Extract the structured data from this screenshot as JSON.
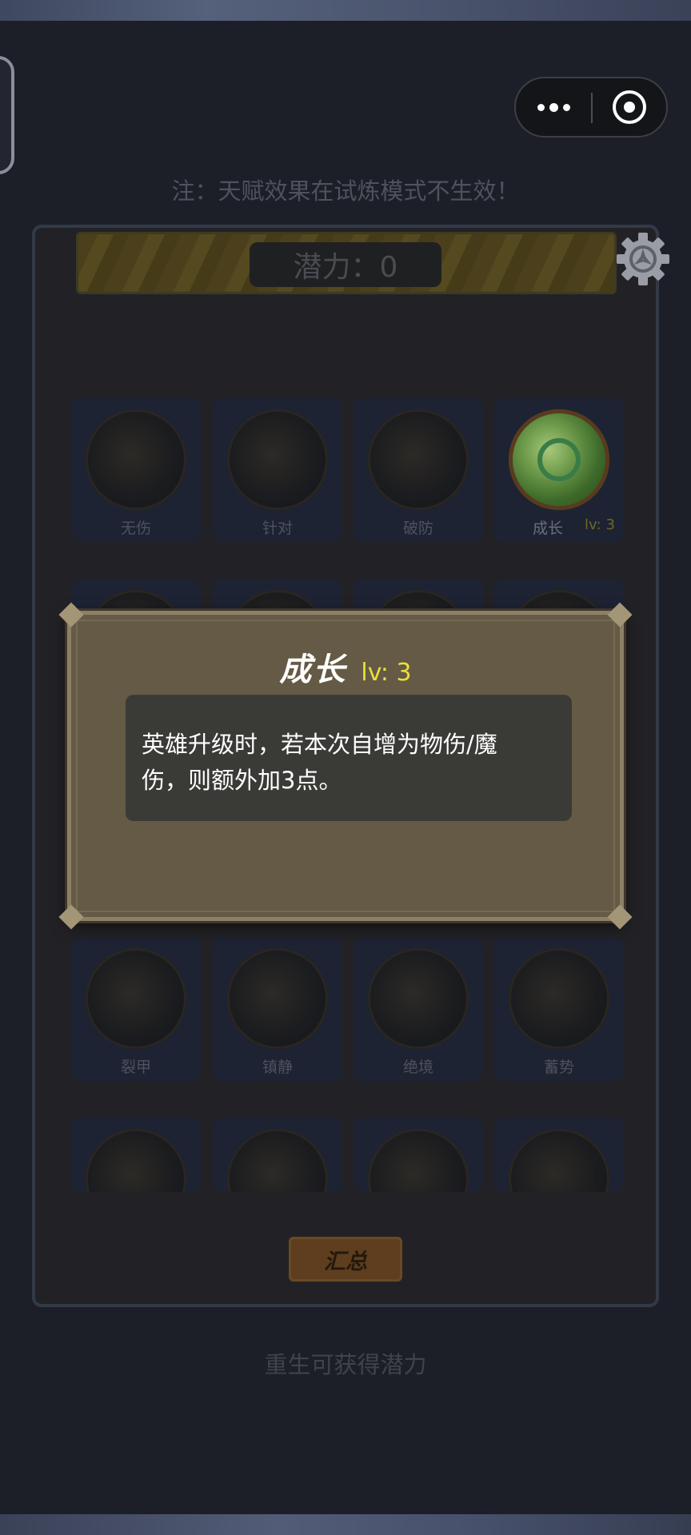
{
  "capsule": {
    "more_icon": "more-dots-icon",
    "close_icon": "target-circle-icon"
  },
  "notice": "注：天赋效果在试炼模式不生效！",
  "header": {
    "potential_label": "潜力：0",
    "settings_icon": "gear-icon"
  },
  "cards_row1": [
    {
      "label": "无伤"
    },
    {
      "label": "针对"
    },
    {
      "label": "破防"
    },
    {
      "label": "成长",
      "level": "lv: 3"
    }
  ],
  "cards_row3": [
    {
      "label": "裂甲"
    },
    {
      "label": "镇静"
    },
    {
      "label": "绝境"
    },
    {
      "label": "蓄势"
    }
  ],
  "summary_button": "汇总",
  "rebirth_hint": "重生可获得潜力",
  "popup": {
    "title": "成长",
    "level": "lv: 3",
    "description": "英雄升级时，若本次自增为物伤/魔伤，则额外加3点。"
  },
  "colors": {
    "popup_bg": "#645a45",
    "level_yellow": "#e8e03a",
    "panel_bg": "#222226"
  }
}
